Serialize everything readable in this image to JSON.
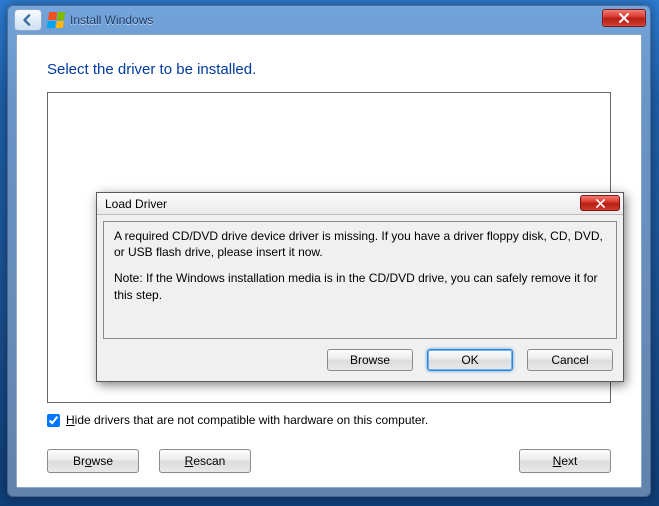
{
  "main": {
    "title": "Install Windows",
    "heading": "Select the driver to be installed.",
    "hide_checkbox_label_pre": "H",
    "hide_checkbox_label_post": "ide drivers that are not compatible with hardware on this computer.",
    "buttons": {
      "browse_pre": "Br",
      "browse_u": "o",
      "browse_post": "wse",
      "rescan_pre": "",
      "rescan_u": "R",
      "rescan_post": "escan",
      "next_pre": "",
      "next_u": "N",
      "next_post": "ext"
    }
  },
  "dialog": {
    "title": "Load Driver",
    "para1": "A required CD/DVD drive device driver is missing. If you have a driver floppy disk, CD, DVD, or USB flash drive, please insert it now.",
    "para2": "Note: If the Windows installation media is in the CD/DVD drive, you can safely remove it for this step.",
    "buttons": {
      "browse": "Browse",
      "ok": "OK",
      "cancel": "Cancel"
    }
  }
}
